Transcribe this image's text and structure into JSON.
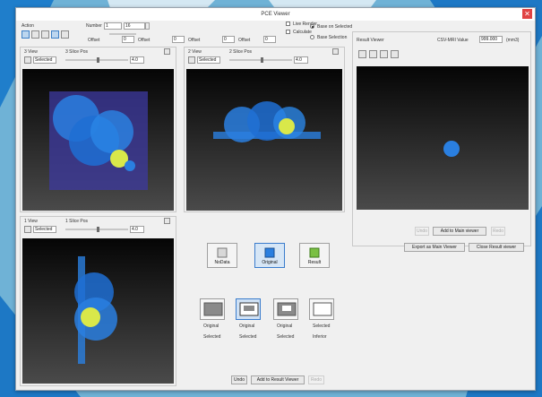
{
  "window": {
    "title": "PCE Viewer",
    "close_glyph": "✕"
  },
  "toolbar": {
    "group_label": "Action",
    "number_label": "Number",
    "number_value": "1",
    "number_value2": "16",
    "offset_fields": [
      {
        "label": "Offset",
        "value": "0"
      },
      {
        "label": "Offset",
        "value": "0"
      },
      {
        "label": "Offset",
        "value": "0"
      },
      {
        "label": "Offset",
        "value": "0"
      }
    ],
    "live_render_label": "Live Render",
    "calculate_label": "Calculate",
    "radio_options": [
      "Base on Selected",
      "Base Selection"
    ]
  },
  "view1": {
    "title": "3 View",
    "subtitle": "3 Slice Pos",
    "color_select": "Selected",
    "value": "4.0"
  },
  "view2": {
    "title": "2 View",
    "subtitle": "2 Slice Pos",
    "color_select": "Selected",
    "value": "4.0"
  },
  "view3": {
    "title": "1 View",
    "subtitle": "1 Slice Pos",
    "color_select": "Selected",
    "value": "4.0"
  },
  "result_viewer": {
    "title": "Result Viewer",
    "label": "CSV-MRI Value",
    "value": "999.000",
    "unit": "(mm3)"
  },
  "source_buttons": [
    {
      "label": "NoData"
    },
    {
      "label": "Original"
    },
    {
      "label": "Result"
    }
  ],
  "layout_buttons": [
    {
      "label1": "Original",
      "label2": "Selected"
    },
    {
      "label1": "Original",
      "label2": "Selected"
    },
    {
      "label1": "Original",
      "label2": "Selected"
    },
    {
      "label1": "Selected",
      "label2": "Inferior"
    }
  ],
  "center_buttons": {
    "undo": "Undo",
    "add": "Add to Result Viewer",
    "redo": "Redo"
  },
  "right_buttons": {
    "undo": "Undo",
    "add": "Add to Main viewer",
    "redo": "Redo",
    "export_main": "Export as Main Viewer",
    "close_result": "Close Result viewer"
  },
  "colors": {
    "accent": "#3a7ccc",
    "viewport_top": "#050505",
    "blob_blue": "#2e7fe0",
    "blob_yellow": "#d9e84a"
  }
}
